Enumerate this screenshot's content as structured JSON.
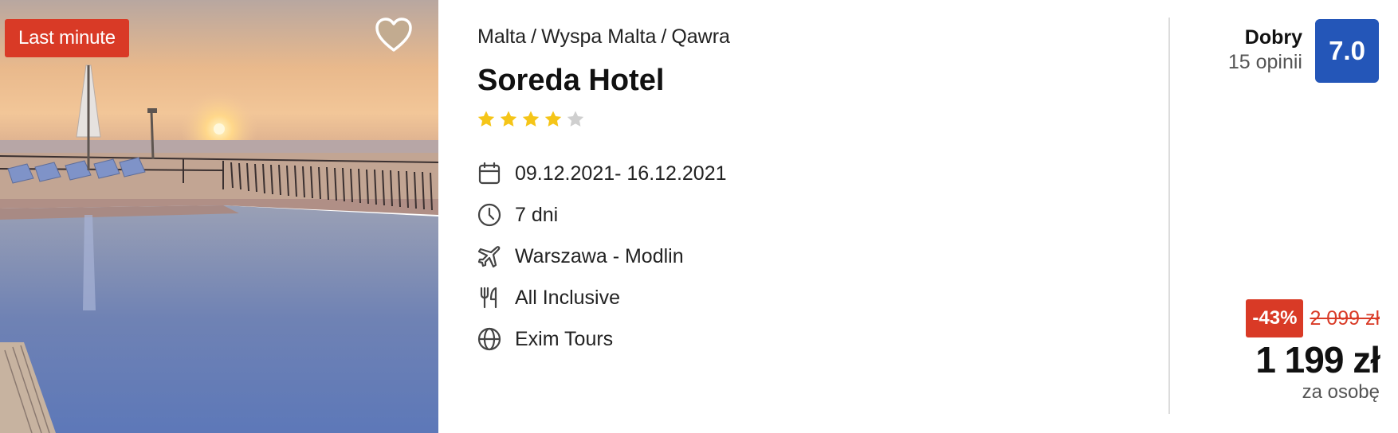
{
  "offer": {
    "badge": "Last minute",
    "breadcrumb": [
      "Malta",
      "Wyspa Malta",
      "Qawra"
    ],
    "breadcrumb_separator": "/",
    "hotel_name": "Soreda Hotel",
    "stars": {
      "filled": 4,
      "total": 5
    },
    "facts": [
      {
        "icon": "calendar-icon",
        "text": "09.12.2021- 16.12.2021"
      },
      {
        "icon": "clock-icon",
        "text": "7 dni"
      },
      {
        "icon": "plane-icon",
        "text": "Warszawa - Modlin"
      },
      {
        "icon": "cutlery-icon",
        "text": "All Inclusive"
      },
      {
        "icon": "globe-icon",
        "text": "Exim Tours"
      }
    ],
    "rating": {
      "word": "Dobry",
      "count": "15 opinii",
      "score": "7.0"
    },
    "price": {
      "discount": "-43%",
      "old": "2 099 zł",
      "current": "1 199 zł",
      "unit": "za osobę"
    }
  },
  "colors": {
    "badge_red": "#d93a26",
    "score_blue": "#2456b8",
    "star_yellow": "#f5c518",
    "star_gray": "#cfcfcf"
  }
}
